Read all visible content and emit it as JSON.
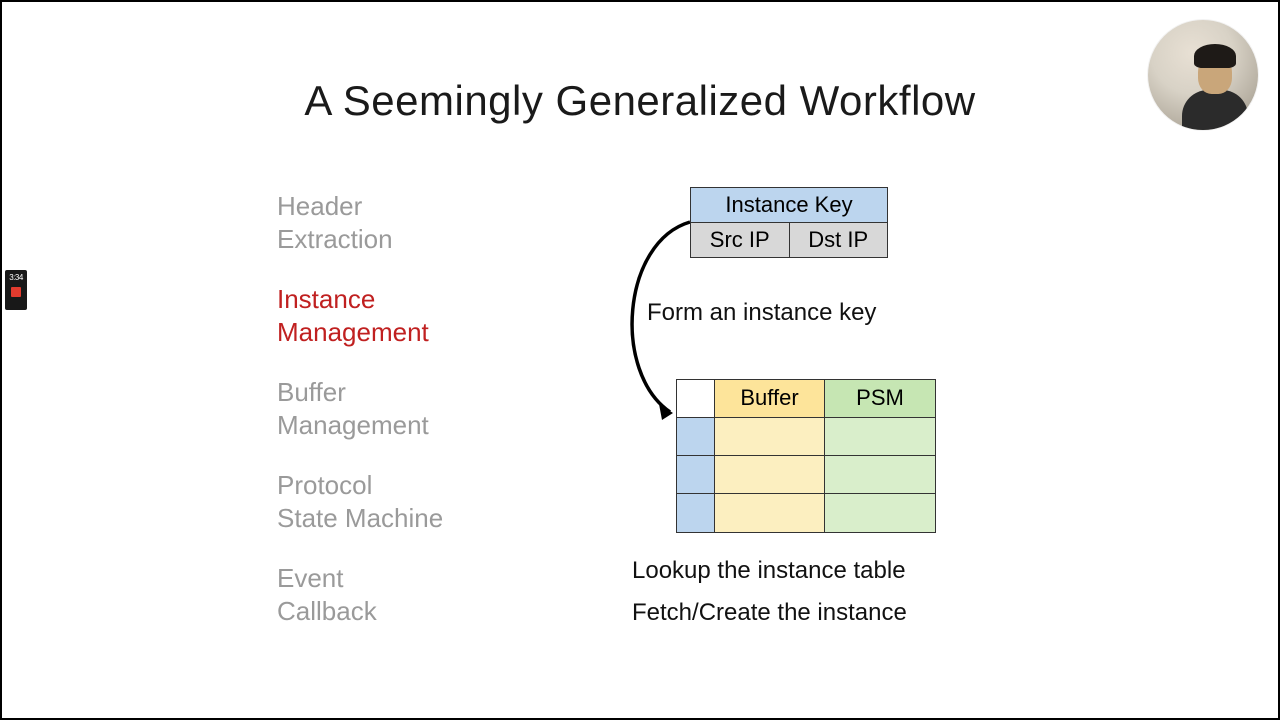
{
  "title": "A Seemingly Generalized Workflow",
  "steps": {
    "header_extraction_l1": "Header",
    "header_extraction_l2": "Extraction",
    "instance_mgmt_l1": "Instance",
    "instance_mgmt_l2": "Management",
    "buffer_mgmt_l1": "Buffer",
    "buffer_mgmt_l2": "Management",
    "protocol_sm_l1": "Protocol",
    "protocol_sm_l2": "State Machine",
    "event_cb_l1": "Event",
    "event_cb_l2": "Callback"
  },
  "diagram": {
    "instance_key_header": "Instance Key",
    "instance_key_cols": {
      "src": "Src IP",
      "dst": "Dst IP"
    },
    "caption_form": "Form an instance key",
    "table_headers": {
      "buffer": "Buffer",
      "psm": "PSM"
    },
    "caption_lookup": "Lookup the instance table",
    "caption_fetch": "Fetch/Create the instance"
  },
  "widget": {
    "timer": "3:34"
  }
}
